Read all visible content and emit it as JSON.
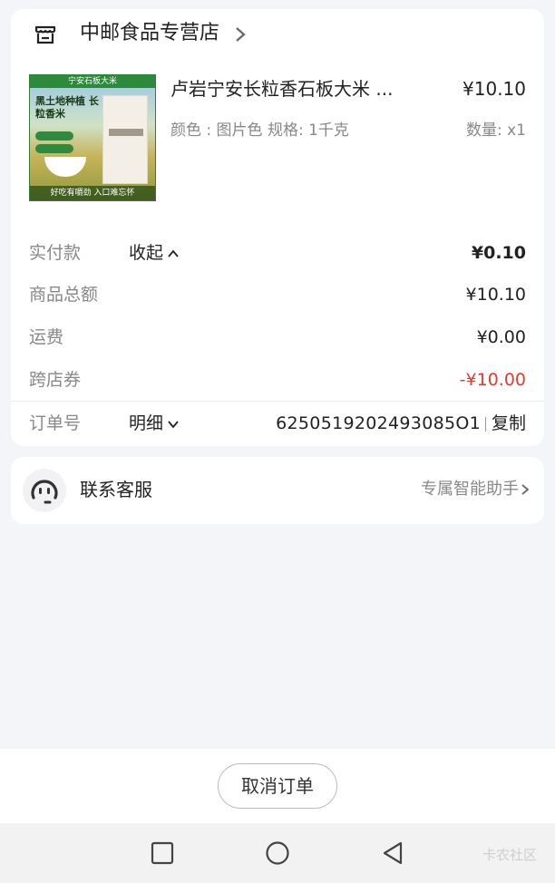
{
  "store": {
    "name": "中邮食品专营店",
    "icon": "store-icon"
  },
  "product": {
    "title": "卢岩宁安长粒香石板大米 ...",
    "price": "¥10.10",
    "spec": "颜色 : 图片色  规格: 1千克",
    "quantity": "数量:  x1",
    "image": {
      "banner": "宁安石板大米",
      "headline": "黑土地种植 长粒香米",
      "footer": "好吃有嚼劲  入口难忘怀"
    }
  },
  "summary": {
    "paid_label": "实付款",
    "collapse_label": "收起",
    "paid_value": "¥0.10",
    "total_label": "商品总额",
    "total_value": "¥10.10",
    "shipping_label": "运费",
    "shipping_value": "¥0.00",
    "coupon_label": "跨店券",
    "coupon_value": "-¥10.00",
    "coupon_color": "#e23b30"
  },
  "order": {
    "label": "订单号",
    "detail_label": "明细",
    "number": "6250519202493085O1",
    "copy_label": "复制"
  },
  "service": {
    "label": "联系客服",
    "assistant": "专属智能助手"
  },
  "actions": {
    "cancel_label": "取消订单"
  },
  "watermark": "卡农社区"
}
